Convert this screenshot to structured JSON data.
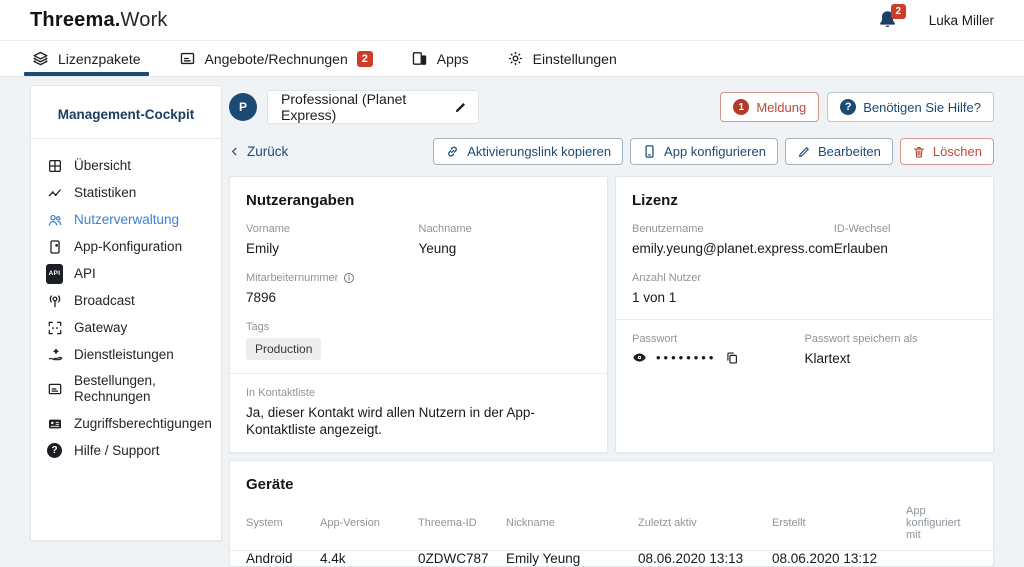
{
  "topbar": {
    "logo_bold": "Threema.",
    "logo_light": "Work",
    "notification_count": "2",
    "user_name": "Luka Miller"
  },
  "tabs": [
    {
      "label": "Lizenzpakete",
      "active": true
    },
    {
      "label": "Angebote/Rechnungen",
      "badge": "2"
    },
    {
      "label": "Apps"
    },
    {
      "label": "Einstellungen"
    }
  ],
  "sidebar": {
    "title": "Management-Cockpit",
    "items": [
      {
        "label": "Übersicht"
      },
      {
        "label": "Statistiken"
      },
      {
        "label": "Nutzerverwaltung",
        "active": true
      },
      {
        "label": "App-Konfiguration"
      },
      {
        "label": "API"
      },
      {
        "label": "Broadcast"
      },
      {
        "label": "Gateway"
      },
      {
        "label": "Dienstleistungen"
      },
      {
        "label": "Bestellungen, Rechnungen"
      },
      {
        "label": "Zugriffsberechtigungen"
      },
      {
        "label": "Hilfe / Support"
      }
    ],
    "api_icon_label": "API"
  },
  "header": {
    "avatar_letter": "P",
    "package_name": "Professional (Planet Express)",
    "meldung_label": "Meldung",
    "meldung_badge": "1",
    "help_label": "Benötigen Sie Hilfe?"
  },
  "toolbar": {
    "back_label": "Zurück",
    "copy_link_label": "Aktivierungslink kopieren",
    "configure_label": "App konfigurieren",
    "edit_label": "Bearbeiten",
    "delete_label": "Löschen"
  },
  "user_card": {
    "title": "Nutzerangaben",
    "vorname_label": "Vorname",
    "vorname": "Emily",
    "nachname_label": "Nachname",
    "nachname": "Yeung",
    "mitarbeiter_label": "Mitarbeiternummer",
    "mitarbeiter": "7896",
    "tags_label": "Tags",
    "tag": "Production",
    "kontakt_label": "In Kontaktliste",
    "kontakt_value": "Ja, dieser Kontakt wird allen Nutzern in der App-Kontaktliste angezeigt."
  },
  "license_card": {
    "title": "Lizenz",
    "benutzername_label": "Benutzername",
    "benutzername": "emily.yeung@planet.express.com",
    "idwechsel_label": "ID-Wechsel",
    "idwechsel": "Erlauben",
    "anzahl_label": "Anzahl Nutzer",
    "anzahl": "1 von 1",
    "passwort_label": "Passwort",
    "passwort_masked": "••••••••",
    "speichern_label": "Passwort speichern als",
    "speichern": "Klartext"
  },
  "devices_card": {
    "title": "Geräte",
    "columns": [
      "System",
      "App-Version",
      "Threema-ID",
      "Nickname",
      "Zuletzt aktiv",
      "Erstellt",
      "App konfiguriert mit"
    ],
    "rows": [
      [
        "Android",
        "4.4k",
        "0ZDWC787",
        "Emily Yeung",
        "08.06.2020 13:13",
        "08.06.2020 13:12",
        ""
      ]
    ]
  },
  "colors": {
    "navy": "#1c4a74",
    "active_blue": "#3c82d4",
    "alert_red": "#bd4936",
    "badge_red": "#cd3d2c",
    "page_bg": "#f0f3f6"
  }
}
